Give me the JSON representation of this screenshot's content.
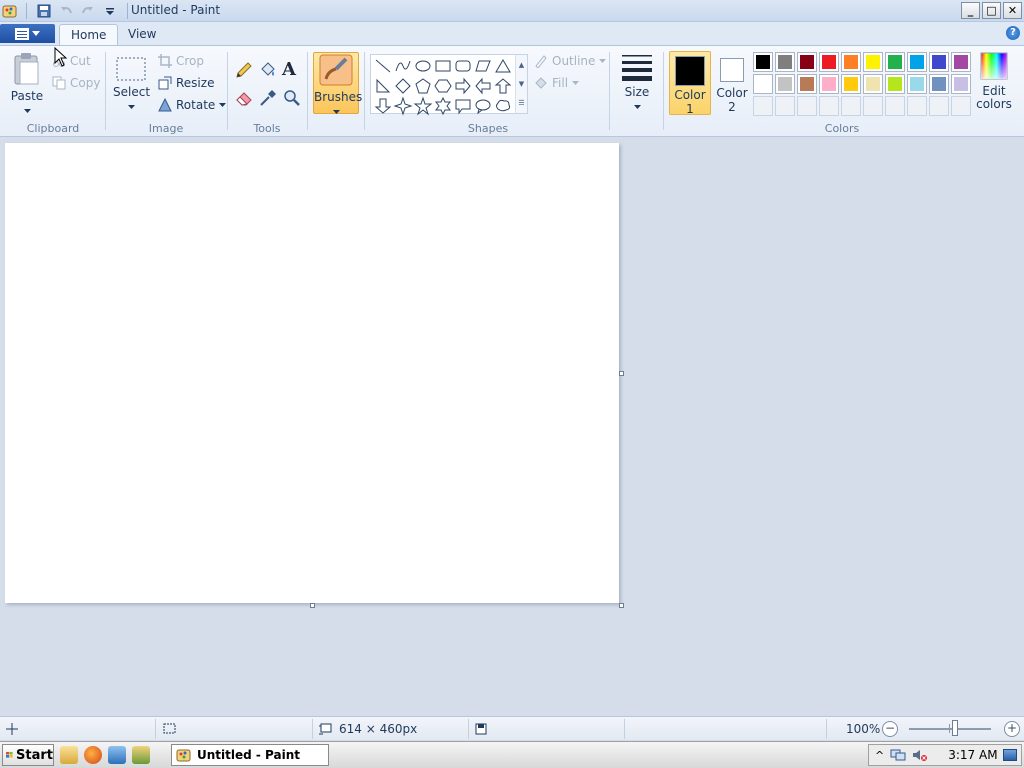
{
  "window": {
    "title": "Untitled - Paint",
    "minimize": "_",
    "maximize": "□",
    "close": "✕"
  },
  "ribbon_tabs": {
    "home": "Home",
    "view": "View",
    "help": "?"
  },
  "clipboard": {
    "label": "Clipboard",
    "paste": "Paste",
    "cut": "Cut",
    "copy": "Copy"
  },
  "image": {
    "label": "Image",
    "select": "Select",
    "crop": "Crop",
    "resize": "Resize",
    "rotate": "Rotate"
  },
  "tools": {
    "label": "Tools"
  },
  "brushes": {
    "label": "Brushes"
  },
  "shapes": {
    "label": "Shapes",
    "outline": "Outline",
    "fill": "Fill"
  },
  "size": {
    "label": "Size"
  },
  "colors": {
    "label": "Colors",
    "color1_line1": "Color",
    "color1_line2": "1",
    "color2_line1": "Color",
    "color2_line2": "2",
    "edit_line1": "Edit",
    "edit_line2": "colors",
    "color1_value": "#000000",
    "color2_value": "#ffffff",
    "palette_row1": [
      "#000000",
      "#7f7f7f",
      "#880015",
      "#ed1c24",
      "#ff7f27",
      "#fff200",
      "#22b14c",
      "#00a2e8",
      "#3f48cc",
      "#a349a4"
    ],
    "palette_row2": [
      "#ffffff",
      "#c3c3c3",
      "#b97a57",
      "#ffaec9",
      "#ffc90e",
      "#efe4b0",
      "#b5e61d",
      "#99d9ea",
      "#7092be",
      "#c8bfe7"
    ]
  },
  "statusbar": {
    "dimensions": "614 × 460px",
    "zoom": "100%",
    "zoom_out": "−",
    "zoom_in": "+"
  },
  "taskbar": {
    "start": "Start",
    "task_item": "Untitled - Paint",
    "clock": "3:17 AM"
  }
}
